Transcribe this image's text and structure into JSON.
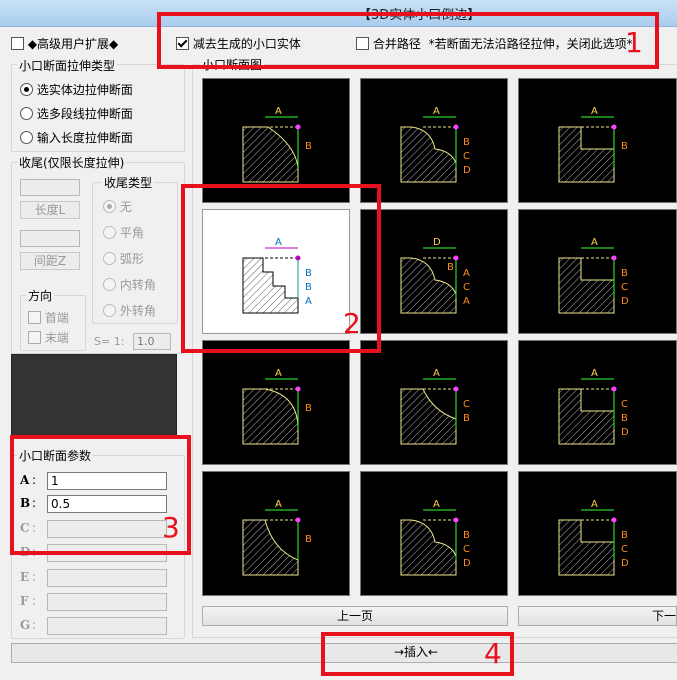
{
  "window": {
    "title": "【3D实体小口倒边】"
  },
  "top": {
    "advanced_label": "◆高级用户扩展◆",
    "subtract_label": "减去生成的小口实体",
    "merge_label": "合并路径",
    "merge_note": "*若断面无法沿路径拉伸，关闭此选项*"
  },
  "stretch": {
    "title": "小口断面拉伸类型",
    "options": [
      "选实体边拉伸断面",
      "选多段线拉伸断面",
      "输入长度拉伸断面"
    ]
  },
  "tail": {
    "title": "收尾(仅限长度拉伸)",
    "length_btn": "长度L",
    "gap_btn": "间距Z",
    "type_title": "收尾类型",
    "types": [
      "无",
      "平角",
      "弧形",
      "内转角",
      "外转角"
    ],
    "dir_title": "方向",
    "dirs": [
      "首端",
      "末端"
    ],
    "s_label": "S= 1:",
    "s_value": "1.0"
  },
  "params": {
    "title": "小口断面参数",
    "rows": [
      {
        "label": "A",
        "value": "1"
      },
      {
        "label": "B",
        "value": "0.5"
      },
      {
        "label": "C",
        "value": ""
      },
      {
        "label": "D",
        "value": ""
      },
      {
        "label": "E",
        "value": ""
      },
      {
        "label": "F",
        "value": ""
      },
      {
        "label": "G",
        "value": ""
      }
    ]
  },
  "sections": {
    "title": "小口断面图",
    "prev_btn": "上一页",
    "next_btn": "下一",
    "cells": [
      {
        "labels": [
          "A",
          "B"
        ]
      },
      {
        "labels": [
          "A",
          "B",
          "C",
          "D"
        ]
      },
      {
        "labels": [
          "A",
          "B"
        ]
      },
      {
        "labels": [
          "A",
          "B",
          "B",
          "A"
        ]
      },
      {
        "labels": [
          "D",
          "A",
          "C",
          "A",
          "B"
        ]
      },
      {
        "labels": [
          "A",
          "B",
          "C",
          "D"
        ]
      },
      {
        "labels": [
          "A",
          "B"
        ]
      },
      {
        "labels": [
          "A",
          "C",
          "B"
        ]
      },
      {
        "labels": [
          "A",
          "C",
          "B",
          "D"
        ]
      },
      {
        "labels": [
          "A",
          "B"
        ]
      },
      {
        "labels": [
          "A",
          "B",
          "C",
          "D"
        ]
      },
      {
        "labels": [
          "A",
          "B",
          "C",
          "D"
        ]
      }
    ]
  },
  "insert_btn": "→插入←",
  "annotations": [
    "1",
    "2",
    "3",
    "4"
  ]
}
